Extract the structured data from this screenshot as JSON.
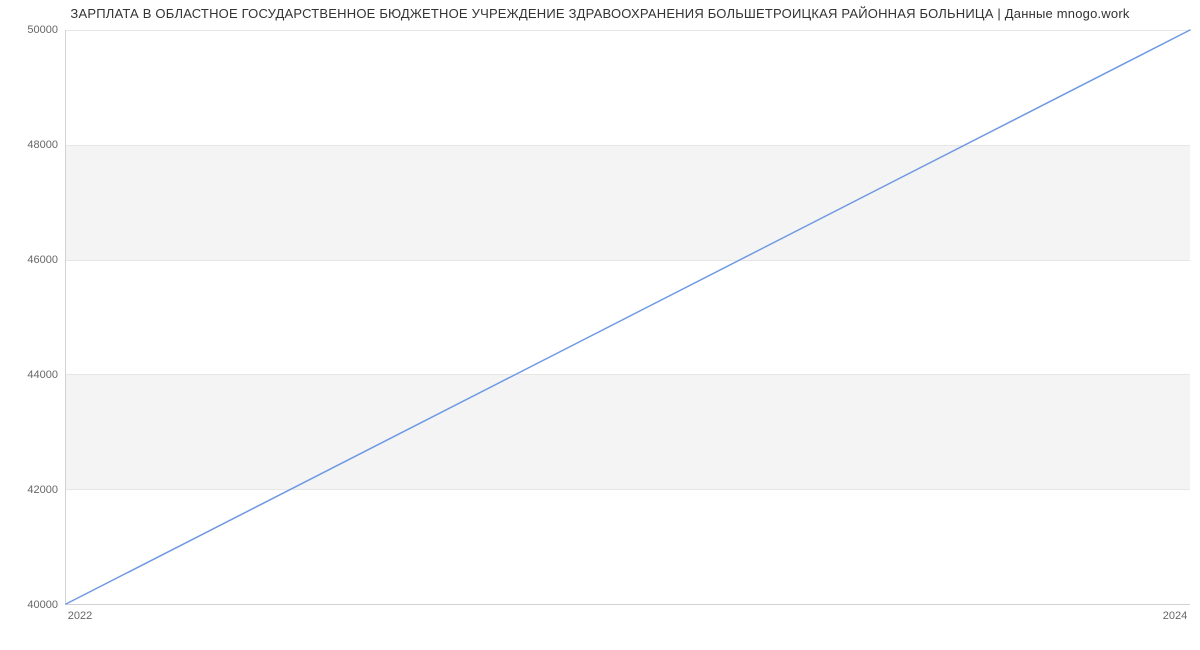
{
  "chart_data": {
    "type": "line",
    "title": "ЗАРПЛАТА В ОБЛАСТНОЕ ГОСУДАРСТВЕННОЕ БЮДЖЕТНОЕ УЧРЕЖДЕНИЕ ЗДРАВООХРАНЕНИЯ БОЛЬШЕТРОИЦКАЯ РАЙОННАЯ БОЛЬНИЦА | Данные mnogo.work",
    "xlabel": "",
    "ylabel": "",
    "x": [
      2022,
      2024
    ],
    "values": [
      40000,
      50000
    ],
    "xlim": [
      2022,
      2024
    ],
    "ylim": [
      40000,
      50000
    ],
    "y_ticks": [
      40000,
      42000,
      44000,
      46000,
      48000,
      50000
    ],
    "x_ticks": [
      2022,
      2024
    ],
    "line_color": "#6f9ae3",
    "band_color": "#f4f4f4",
    "grid": true
  }
}
